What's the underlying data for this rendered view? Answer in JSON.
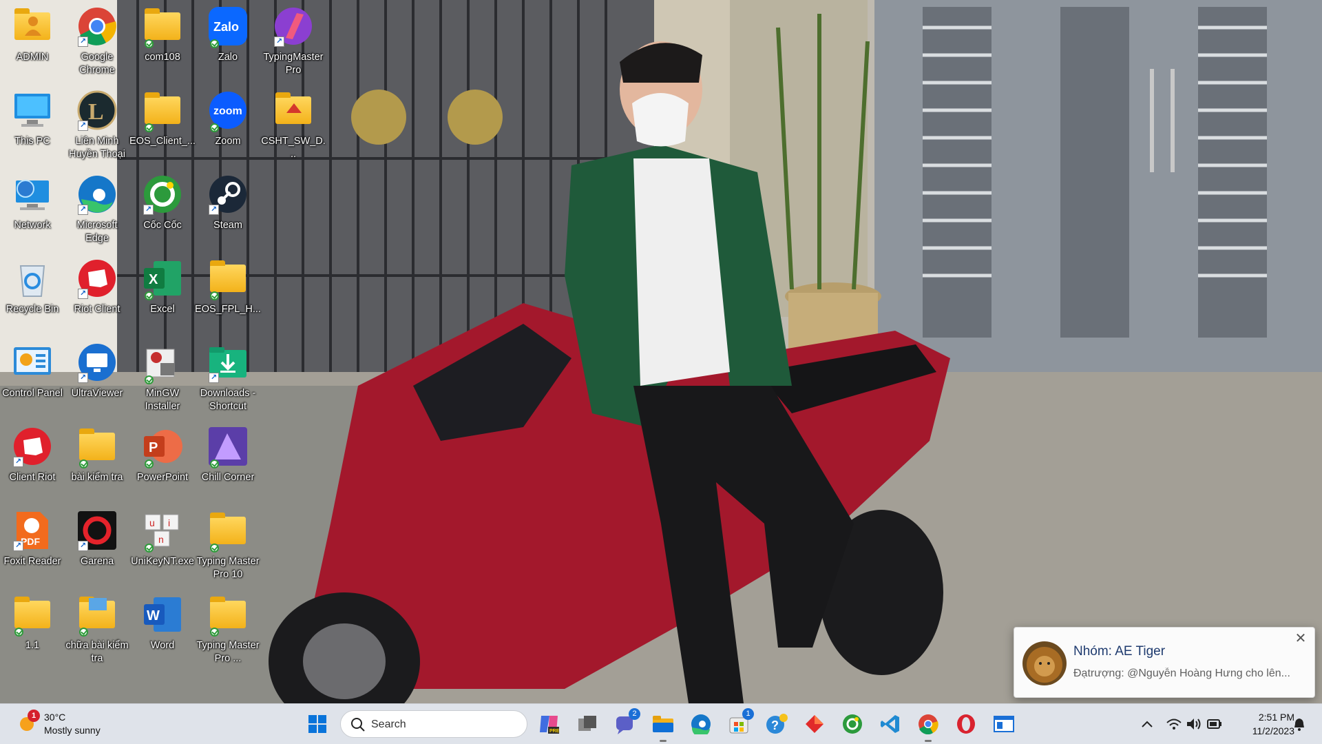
{
  "desktop": {
    "icons": [
      {
        "label": "ADMIN",
        "icon": "user-folder-icon"
      },
      {
        "label": "Google Chrome",
        "icon": "chrome-icon"
      },
      {
        "label": "com108",
        "icon": "folder-icon"
      },
      {
        "label": "Zalo",
        "icon": "zalo-icon"
      },
      {
        "label": "TypingMaster Pro",
        "icon": "typingmaster-icon"
      },
      {
        "label": "This PC",
        "icon": "this-pc-icon"
      },
      {
        "label": "Liên Minh Huyền Thoại",
        "icon": "league-icon"
      },
      {
        "label": "EOS_Client_...",
        "icon": "folder-icon"
      },
      {
        "label": "Zoom",
        "icon": "zoom-icon"
      },
      {
        "label": "CSHT_SW_D...",
        "icon": "folder-icon"
      },
      {
        "label": "Network",
        "icon": "network-icon"
      },
      {
        "label": "Microsoft Edge",
        "icon": "edge-icon"
      },
      {
        "label": "Cốc Cốc",
        "icon": "coccoc-icon"
      },
      {
        "label": "Steam",
        "icon": "steam-icon"
      },
      {
        "label": "Recycle Bin",
        "icon": "recycle-bin-icon"
      },
      {
        "label": "Riot Client",
        "icon": "riot-icon"
      },
      {
        "label": "Excel",
        "icon": "excel-icon"
      },
      {
        "label": "EOS_FPL_H...",
        "icon": "folder-icon"
      },
      {
        "label": "Control Panel",
        "icon": "control-panel-icon"
      },
      {
        "label": "UltraViewer",
        "icon": "ultraviewer-icon"
      },
      {
        "label": "MinGW Installer",
        "icon": "mingw-icon"
      },
      {
        "label": "Downloads - Shortcut",
        "icon": "downloads-icon"
      },
      {
        "label": "Client Riot",
        "icon": "riot-icon"
      },
      {
        "label": "bài kiểm tra",
        "icon": "folder-icon"
      },
      {
        "label": "PowerPoint",
        "icon": "powerpoint-icon"
      },
      {
        "label": "Chill Corner",
        "icon": "chill-corner-icon"
      },
      {
        "label": "Foxit Reader",
        "icon": "foxit-icon"
      },
      {
        "label": "Garena",
        "icon": "garena-icon"
      },
      {
        "label": "UniKeyNT.exe",
        "icon": "unikey-icon"
      },
      {
        "label": "Typing Master Pro 10",
        "icon": "folder-icon"
      },
      {
        "label": "1.1",
        "icon": "folder-icon"
      },
      {
        "label": "chữa bài kiểm tra",
        "icon": "folder-icon"
      },
      {
        "label": "Word",
        "icon": "word-icon"
      },
      {
        "label": "Typing Master Pro ...",
        "icon": "folder-icon"
      }
    ]
  },
  "notification": {
    "title": "Nhóm: AE Tiger",
    "body": "Đạtrượng: @Nguyễn Hoàng Hưng cho lên...",
    "close_label": "✕",
    "avatar": "lion-avatar"
  },
  "taskbar": {
    "weather": {
      "temp": "30°C",
      "condition": "Mostly sunny",
      "badge": "1"
    },
    "search_placeholder": "Search",
    "apps": [
      {
        "name": "start-button",
        "icon": "windows-icon"
      },
      {
        "name": "copilot-button",
        "icon": "copilot-pre-icon"
      },
      {
        "name": "task-view-button",
        "icon": "task-view-icon"
      },
      {
        "name": "teams-chat-button",
        "icon": "chat-icon",
        "badge": "2"
      },
      {
        "name": "file-explorer-button",
        "icon": "folder-icon"
      },
      {
        "name": "edge-button",
        "icon": "edge-icon"
      },
      {
        "name": "store-button",
        "icon": "store-icon",
        "badge": "1"
      },
      {
        "name": "help-button",
        "icon": "help-icon"
      },
      {
        "name": "app-red-button",
        "icon": "diamond-icon"
      },
      {
        "name": "coccoc-button",
        "icon": "coccoc-icon"
      },
      {
        "name": "vscode-button",
        "icon": "vscode-icon"
      },
      {
        "name": "chrome-button",
        "icon": "chrome-icon"
      },
      {
        "name": "opera-button",
        "icon": "opera-icon"
      },
      {
        "name": "window-app-button",
        "icon": "window-icon"
      }
    ],
    "clock": {
      "time": "2:51 PM",
      "date": "11/2/2023"
    }
  }
}
